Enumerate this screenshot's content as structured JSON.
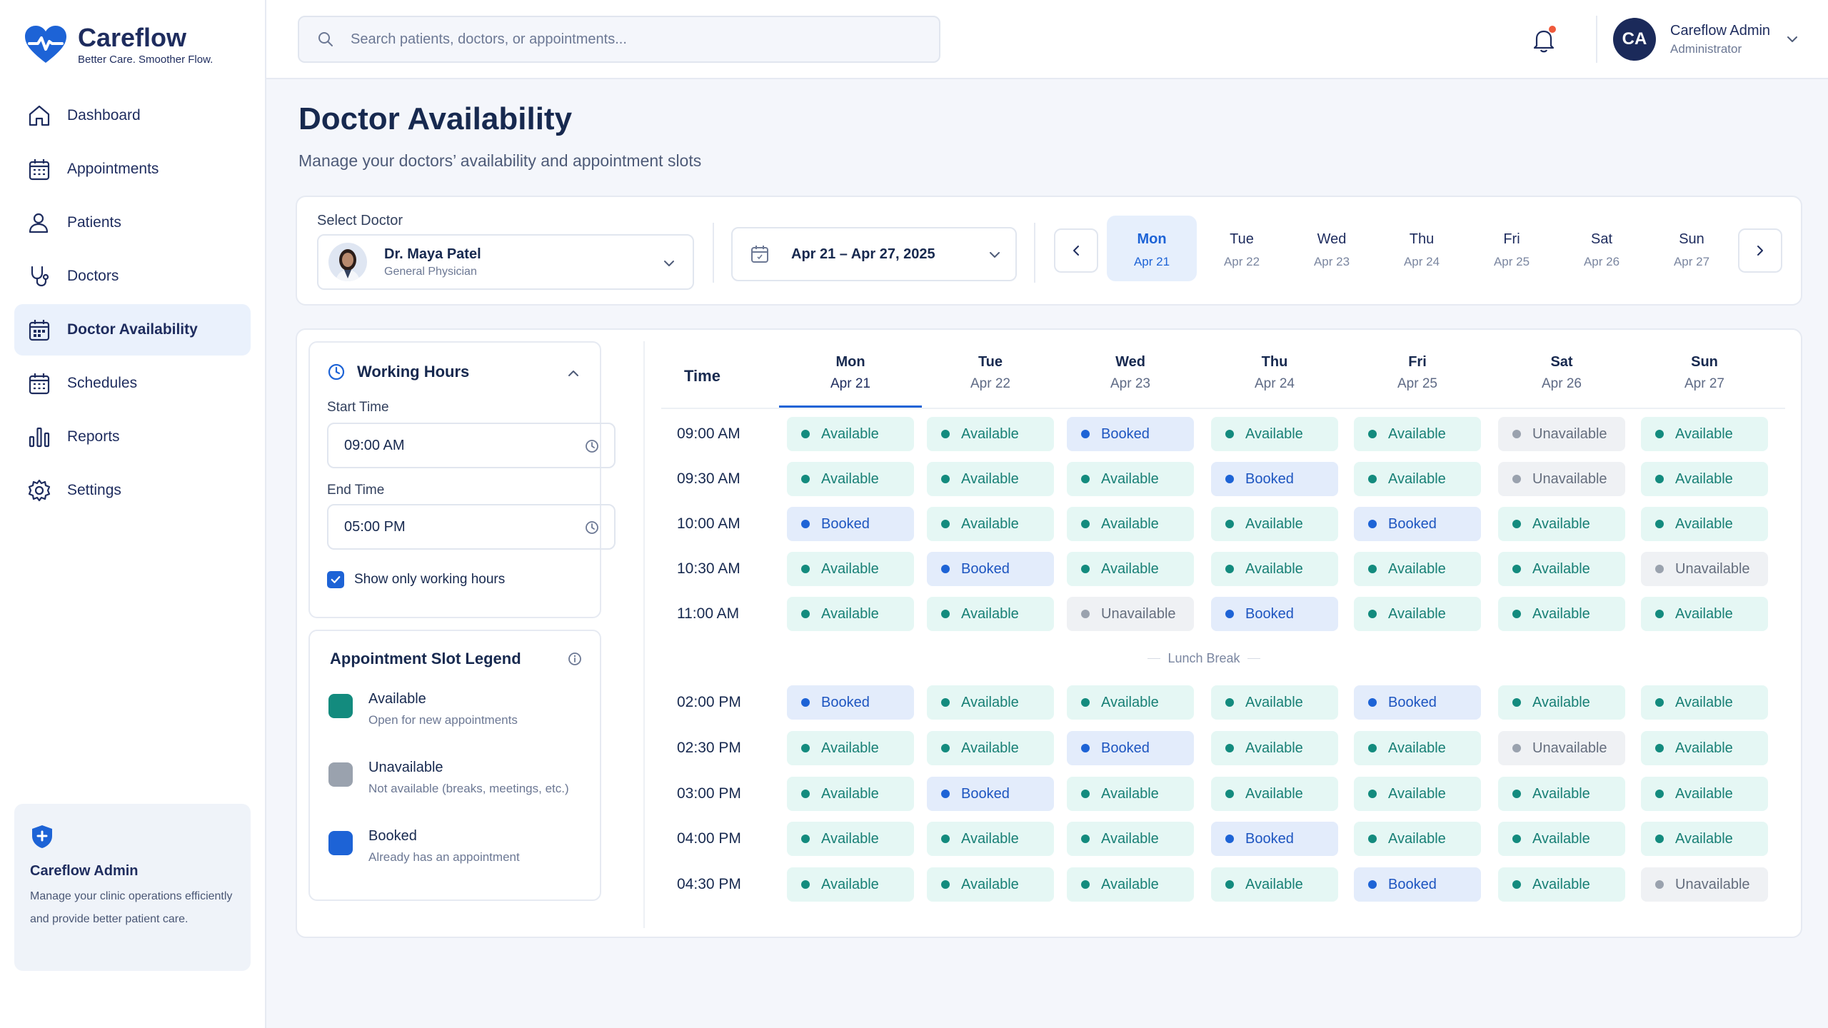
{
  "brand": {
    "name": "Careflow",
    "tagline": "Better Care. Smoother Flow.",
    "accent": "#1d63d6",
    "navy": "#1e2c5e"
  },
  "sidebar": {
    "items": [
      {
        "label": "Dashboard",
        "icon": "home-icon"
      },
      {
        "label": "Appointments",
        "icon": "calendar-icon"
      },
      {
        "label": "Patients",
        "icon": "user-icon"
      },
      {
        "label": "Doctors",
        "icon": "stethoscope-icon"
      },
      {
        "label": "Doctor Availability",
        "icon": "calendar-grid-icon",
        "active": true
      },
      {
        "label": "Schedules",
        "icon": "calendar-grid-icon"
      },
      {
        "label": "Reports",
        "icon": "bar-chart-icon"
      },
      {
        "label": "Settings",
        "icon": "gear-icon"
      }
    ],
    "admin_card": {
      "title": "Careflow Admin",
      "text": "Manage your clinic operations efficiently and provide better patient care."
    }
  },
  "header": {
    "search_placeholder": "Search patients, doctors, or appointments...",
    "user": {
      "initials": "CA",
      "name": "Careflow Admin",
      "role": "Administrator"
    }
  },
  "page": {
    "title": "Doctor Availability",
    "subtitle": "Manage your doctors’ availability and appointment slots"
  },
  "filters": {
    "select_label": "Select Doctor",
    "doctor": {
      "name": "Dr. Maya Patel",
      "role": "General Physician"
    },
    "date_range": "Apr 21 – Apr 27, 2025",
    "days": [
      {
        "day": "Mon",
        "date": "Apr 21",
        "active": true
      },
      {
        "day": "Tue",
        "date": "Apr 22"
      },
      {
        "day": "Wed",
        "date": "Apr 23"
      },
      {
        "day": "Thu",
        "date": "Apr 24"
      },
      {
        "day": "Fri",
        "date": "Apr 25"
      },
      {
        "day": "Sat",
        "date": "Apr 26"
      },
      {
        "day": "Sun",
        "date": "Apr 27"
      }
    ]
  },
  "working_hours": {
    "title": "Working Hours",
    "start_label": "Start Time",
    "start_value": "09:00 AM",
    "end_label": "End Time",
    "end_value": "05:00 PM",
    "checkbox_label": "Show only working hours",
    "checked": true
  },
  "legend": {
    "title": "Appointment Slot Legend",
    "items": [
      {
        "title": "Available",
        "desc": "Open for new appointments",
        "color": "#138b7e"
      },
      {
        "title": "Unavailable",
        "desc": "Not available (breaks, meetings, etc.)",
        "color": "#9aa2ae"
      },
      {
        "title": "Booked",
        "desc": "Already has an appointment",
        "color": "#1d63d6"
      }
    ]
  },
  "schedule": {
    "time_header": "Time",
    "lunch_label": "Lunch Break",
    "columns": [
      {
        "day": "Mon",
        "date": "Apr 21"
      },
      {
        "day": "Tue",
        "date": "Apr 22"
      },
      {
        "day": "Wed",
        "date": "Apr 23"
      },
      {
        "day": "Thu",
        "date": "Apr 24"
      },
      {
        "day": "Fri",
        "date": "Apr 25"
      },
      {
        "day": "Sat",
        "date": "Apr 26"
      },
      {
        "day": "Sun",
        "date": "Apr 27"
      }
    ],
    "status_labels": {
      "a": "Available",
      "b": "Booked",
      "u": "Unavailable"
    },
    "rows": [
      {
        "time": "09:00 AM",
        "slots": [
          "a",
          "a",
          "b",
          "a",
          "a",
          "u",
          "a"
        ]
      },
      {
        "time": "09:30 AM",
        "slots": [
          "a",
          "a",
          "a",
          "b",
          "a",
          "u",
          "a"
        ]
      },
      {
        "time": "10:00 AM",
        "slots": [
          "b",
          "a",
          "a",
          "a",
          "b",
          "a",
          "a"
        ]
      },
      {
        "time": "10:30 AM",
        "slots": [
          "a",
          "b",
          "a",
          "a",
          "a",
          "a",
          "u"
        ]
      },
      {
        "time": "11:00 AM",
        "slots": [
          "a",
          "a",
          "u",
          "b",
          "a",
          "a",
          "a"
        ]
      },
      {
        "time": "02:00 PM",
        "slots": [
          "b",
          "a",
          "a",
          "a",
          "b",
          "a",
          "a"
        ]
      },
      {
        "time": "02:30 PM",
        "slots": [
          "a",
          "a",
          "b",
          "a",
          "a",
          "u",
          "a"
        ]
      },
      {
        "time": "03:00 PM",
        "slots": [
          "a",
          "b",
          "a",
          "a",
          "a",
          "a",
          "a"
        ]
      },
      {
        "time": "04:00 PM",
        "slots": [
          "a",
          "a",
          "a",
          "b",
          "a",
          "a",
          "a"
        ]
      },
      {
        "time": "04:30 PM",
        "slots": [
          "a",
          "a",
          "a",
          "a",
          "b",
          "a",
          "u"
        ]
      }
    ]
  }
}
